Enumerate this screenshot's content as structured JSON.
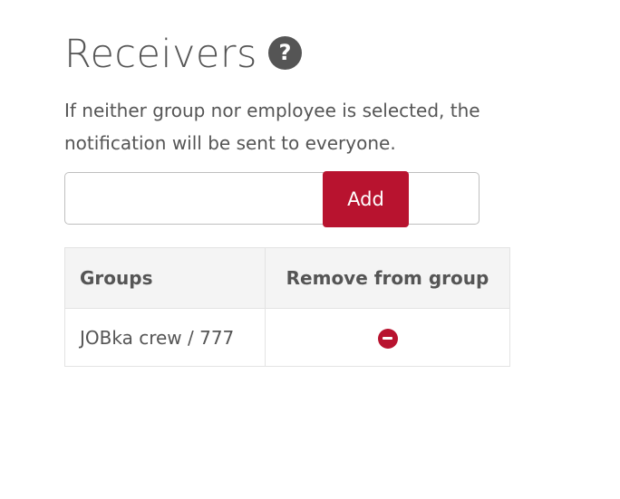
{
  "header": {
    "title": "Receivers",
    "help_icon": "question-circle-icon"
  },
  "description": "If neither group nor employee is selected, the notification will be sent to everyone.",
  "add_form": {
    "input_value": "",
    "input_placeholder": "",
    "add_label": "Add"
  },
  "table": {
    "headers": [
      "Groups",
      "Remove from group"
    ],
    "rows": [
      {
        "group": "JOBka crew / 777",
        "remove_icon": "minus-circle-icon"
      }
    ]
  },
  "colors": {
    "accent": "#b8132f",
    "text": "#555555"
  }
}
